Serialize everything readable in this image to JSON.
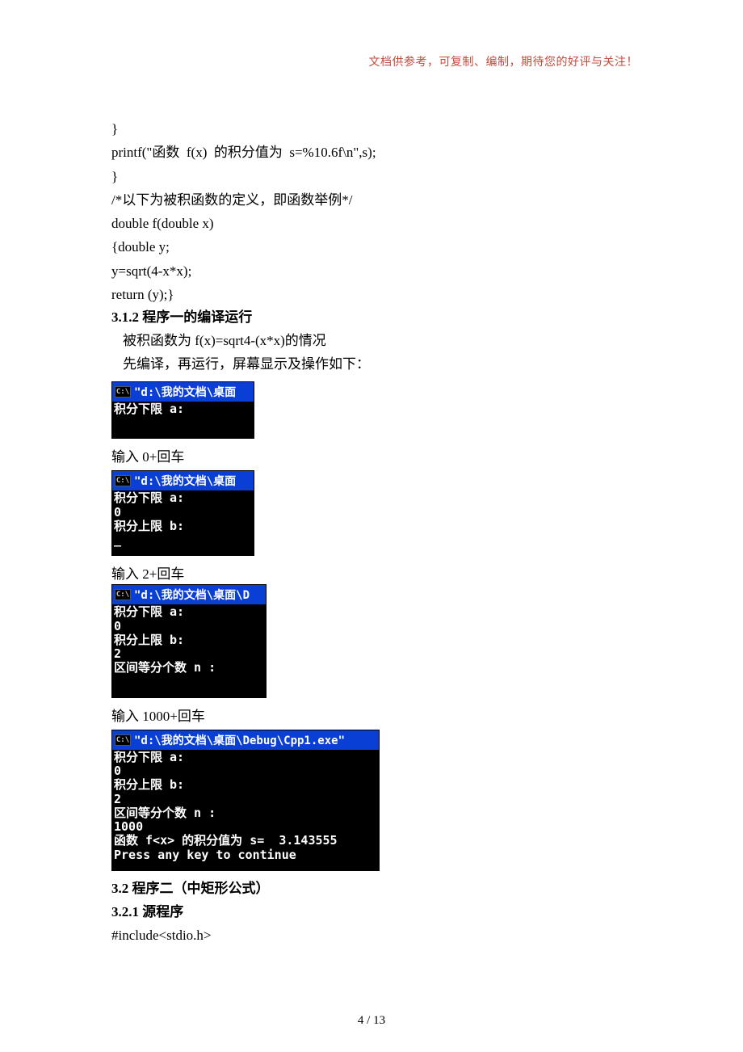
{
  "header_note": "文档供参考，可复制、编制，期待您的好评与关注！",
  "code": {
    "l1": "}",
    "l2": "printf(\"函数  f(x)  的积分值为  s=%10.6f\\n\",s);",
    "l3": "}",
    "l4": "/*以下为被积函数的定义，即函数举例*/",
    "l5": "double f(double x)",
    "l6": "{double y;",
    "l7": "y=sqrt(4-x*x);",
    "l8": "return (y);}"
  },
  "h1": "3.1.2 程序一的编译运行",
  "p1": "被积函数为 f(x)=sqrt4-(x*x)的情况",
  "p2": "先编译，再运行，屏幕显示及操作如下：",
  "term1": {
    "title": "\"d:\\我的文档\\桌面",
    "body": "积分下限 a:\n "
  },
  "cap1": "输入 0+回车",
  "term2": {
    "title": "\"d:\\我的文档\\桌面",
    "body": "积分下限 a:\n0\n积分上限 b:\n_"
  },
  "cap2": "输入 2+回车",
  "term3": {
    "title": "\"d:\\我的文档\\桌面\\D",
    "body": "积分下限 a:\n0\n积分上限 b:\n2\n区间等分个数 n :\n "
  },
  "cap3": "输入 1000+回车",
  "term4": {
    "title": "\"d:\\我的文档\\桌面\\Debug\\Cpp1.exe\"",
    "body": "积分下限 a:\n0\n积分上限 b:\n2\n区间等分个数 n :\n1000\n函数 f<x> 的积分值为 s=  3.143555\nPress any key to continue"
  },
  "h2": "3.2 程序二（中矩形公式）",
  "h3": "3.2.1 源程序",
  "p3": "#include<stdio.h>",
  "footer": "4  /  13",
  "icon_label": "C:\\"
}
